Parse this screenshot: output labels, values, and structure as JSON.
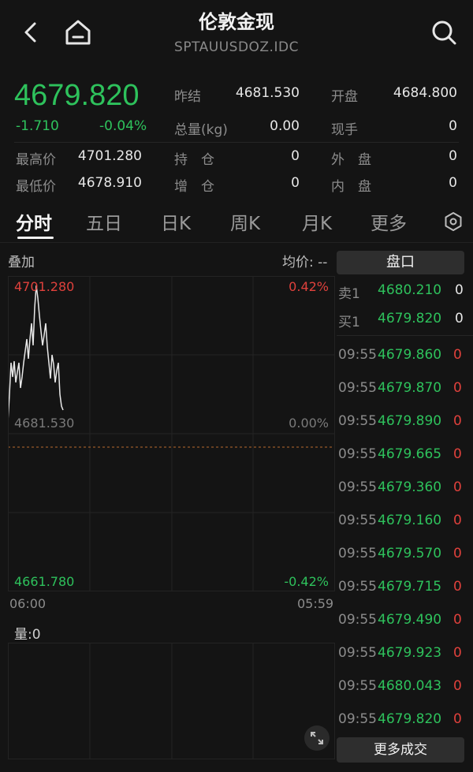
{
  "header": {
    "title": "伦敦金现",
    "code": "SPTAUUSDOZ.IDC"
  },
  "quote": {
    "price": "4679.820",
    "change": "-1.710",
    "change_pct": "-0.04%",
    "stats": [
      {
        "label": "昨结",
        "value": "4681.530"
      },
      {
        "label": "开盘",
        "value": "4684.800"
      },
      {
        "label": "总量(kg)",
        "value": "0.00"
      },
      {
        "label": "现手",
        "value": "0"
      },
      {
        "label": "最高价",
        "value": "4701.280"
      },
      {
        "label": "持　仓",
        "value": "0"
      },
      {
        "label": "外　盘",
        "value": "0"
      },
      {
        "label": "最低价",
        "value": "4678.910"
      },
      {
        "label": "增　仓",
        "value": "0"
      },
      {
        "label": "内　盘",
        "value": "0"
      }
    ]
  },
  "tabs": [
    "分时",
    "五日",
    "日K",
    "周K",
    "月K",
    "更多"
  ],
  "active_tab": "分时",
  "chart_panel": {
    "overlay_label": "叠加",
    "avg_label": "均价: --",
    "high_price": "4701.280",
    "high_pct": "0.42%",
    "mid_price": "4681.530",
    "mid_pct": "0.00%",
    "low_price": "4661.780",
    "low_pct": "-0.42%",
    "time_start": "06:00",
    "time_end": "05:59",
    "volume_label": "量:0"
  },
  "order_book": {
    "pankou_label": "盘口",
    "ask": {
      "label": "卖1",
      "price": "4680.210",
      "qty": "0"
    },
    "bid": {
      "label": "买1",
      "price": "4679.820",
      "qty": "0"
    },
    "trades": [
      {
        "time": "09:55",
        "price": "4679.860",
        "vol": "0"
      },
      {
        "time": "09:55",
        "price": "4679.870",
        "vol": "0"
      },
      {
        "time": "09:55",
        "price": "4679.890",
        "vol": "0"
      },
      {
        "time": "09:55",
        "price": "4679.665",
        "vol": "0"
      },
      {
        "time": "09:55",
        "price": "4679.360",
        "vol": "0"
      },
      {
        "time": "09:55",
        "price": "4679.160",
        "vol": "0"
      },
      {
        "time": "09:55",
        "price": "4679.570",
        "vol": "0"
      },
      {
        "time": "09:55",
        "price": "4679.715",
        "vol": "0"
      },
      {
        "time": "09:55",
        "price": "4679.490",
        "vol": "0"
      },
      {
        "time": "09:55",
        "price": "4679.923",
        "vol": "0"
      },
      {
        "time": "09:55",
        "price": "4680.043",
        "vol": "0"
      },
      {
        "time": "09:55",
        "price": "4679.820",
        "vol": "0"
      }
    ],
    "more_label": "更多成交"
  },
  "colors": {
    "up": "#e0413c",
    "down": "#2ec25c",
    "background": "#141414"
  },
  "icons": [
    "back-arrow-icon",
    "home-icon",
    "search-icon",
    "settings-icon",
    "expand-icon"
  ]
}
